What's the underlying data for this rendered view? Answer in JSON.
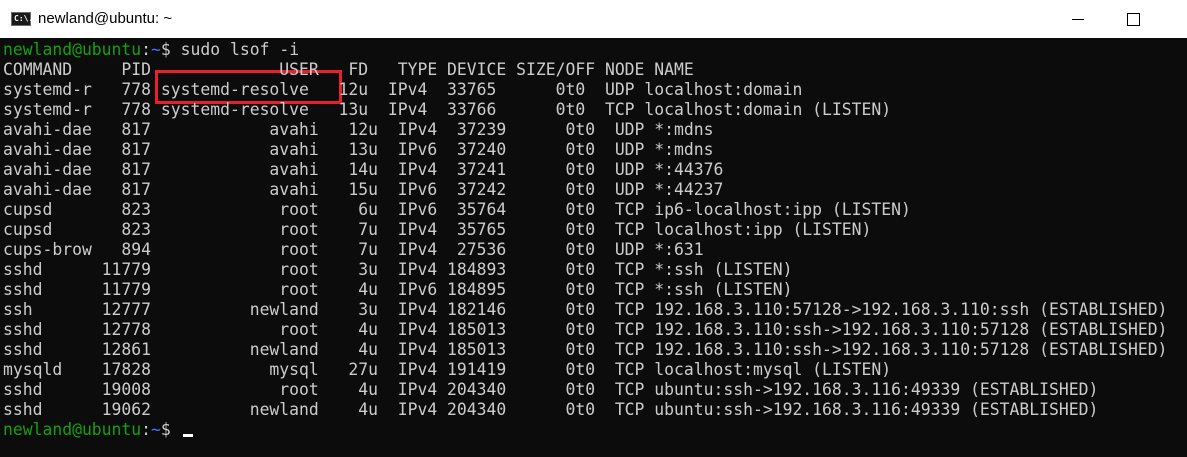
{
  "window": {
    "title": "newland@ubuntu: ~",
    "icon": "cmd-terminal-icon",
    "icon_text": "C:\\."
  },
  "colors": {
    "background": "#0c0c0c",
    "text": "#cccccc",
    "prompt_user": "#13a10e",
    "prompt_path": "#3b78ff",
    "highlight_border": "#e8202a"
  },
  "prompt": {
    "user_host": "newland@ubuntu",
    "separator": ":",
    "path": "~"
  },
  "command_line": {
    "text": "$ sudo lsof -i"
  },
  "output_lines": [
    "COMMAND     PID             USER   FD   TYPE DEVICE SIZE/OFF NODE NAME",
    "systemd-r   778 systemd-resolve   12u  IPv4  33765      0t0  UDP localhost:domain",
    "systemd-r   778 systemd-resolve   13u  IPv4  33766      0t0  TCP localhost:domain (LISTEN)",
    "avahi-dae   817            avahi   12u  IPv4  37239      0t0  UDP *:mdns",
    "avahi-dae   817            avahi   13u  IPv6  37240      0t0  UDP *:mdns",
    "avahi-dae   817            avahi   14u  IPv4  37241      0t0  UDP *:44376",
    "avahi-dae   817            avahi   15u  IPv6  37242      0t0  UDP *:44237",
    "cupsd       823             root    6u  IPv6  35764      0t0  TCP ip6-localhost:ipp (LISTEN)",
    "cupsd       823             root    7u  IPv4  35765      0t0  TCP localhost:ipp (LISTEN)",
    "cups-brow   894             root    7u  IPv4  27536      0t0  UDP *:631",
    "sshd      11779             root    3u  IPv4 184893      0t0  TCP *:ssh (LISTEN)",
    "sshd      11779             root    4u  IPv6 184895      0t0  TCP *:ssh (LISTEN)",
    "ssh       12777          newland    3u  IPv4 182146      0t0  TCP 192.168.3.110:57128->192.168.3.110:ssh (ESTABLISHED)",
    "sshd      12778             root    4u  IPv4 185013      0t0  TCP 192.168.3.110:ssh->192.168.3.110:57128 (ESTABLISHED)",
    "sshd      12861          newland    4u  IPv4 185013      0t0  TCP 192.168.3.110:ssh->192.168.3.110:57128 (ESTABLISHED)",
    "mysqld    17828            mysql   27u  IPv4 191419      0t0  TCP localhost:mysql (LISTEN)",
    "sshd      19008             root    4u  IPv4 204340      0t0  TCP ubuntu:ssh->192.168.3.116:49339 (ESTABLISHED)",
    "sshd      19062          newland    4u  IPv4 204340      0t0  TCP ubuntu:ssh->192.168.3.116:49339 (ESTABLISHED)"
  ],
  "final_prompt": {
    "user_host": "newland@ubuntu",
    "separator": ":",
    "path": "~",
    "symbol": "$"
  }
}
